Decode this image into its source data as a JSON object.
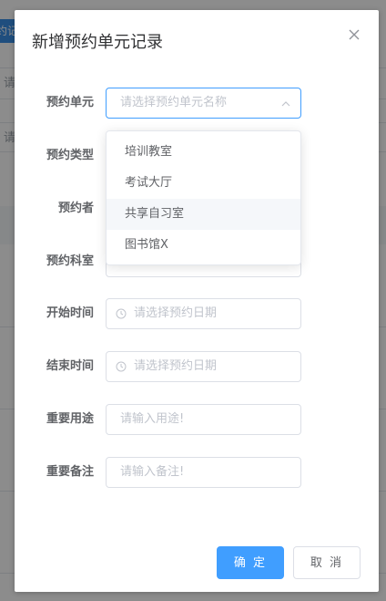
{
  "background": {
    "badge": "约记",
    "placeholders": [
      "请",
      "请"
    ]
  },
  "dialog": {
    "title": "新增预约单元记录",
    "icons": {
      "close": "close-icon",
      "clock": "clock-icon",
      "chevron": "chevron-up-icon"
    }
  },
  "form": {
    "unit": {
      "label": "预约单元",
      "placeholder": "请选择预约单元名称"
    },
    "type": {
      "label": "预约类型"
    },
    "person": {
      "label": "预约者"
    },
    "dept": {
      "label": "预约科室"
    },
    "start": {
      "label": "开始时间",
      "placeholder": "请选择预约日期"
    },
    "end": {
      "label": "结束时间",
      "placeholder": "请选择预约日期"
    },
    "purpose": {
      "label": "重要用途",
      "placeholder": "请输入用途!"
    },
    "remark": {
      "label": "重要备注",
      "placeholder": "请输入备注!"
    }
  },
  "dropdown": {
    "options": [
      "培训教室",
      "考试大厅",
      "共享自习室",
      "图书馆X"
    ],
    "hovered_index": 2
  },
  "footer": {
    "confirm": "确 定",
    "cancel": "取 消"
  },
  "colors": {
    "primary": "#409eff",
    "mask": "rgba(0,0,0,0.45)"
  }
}
